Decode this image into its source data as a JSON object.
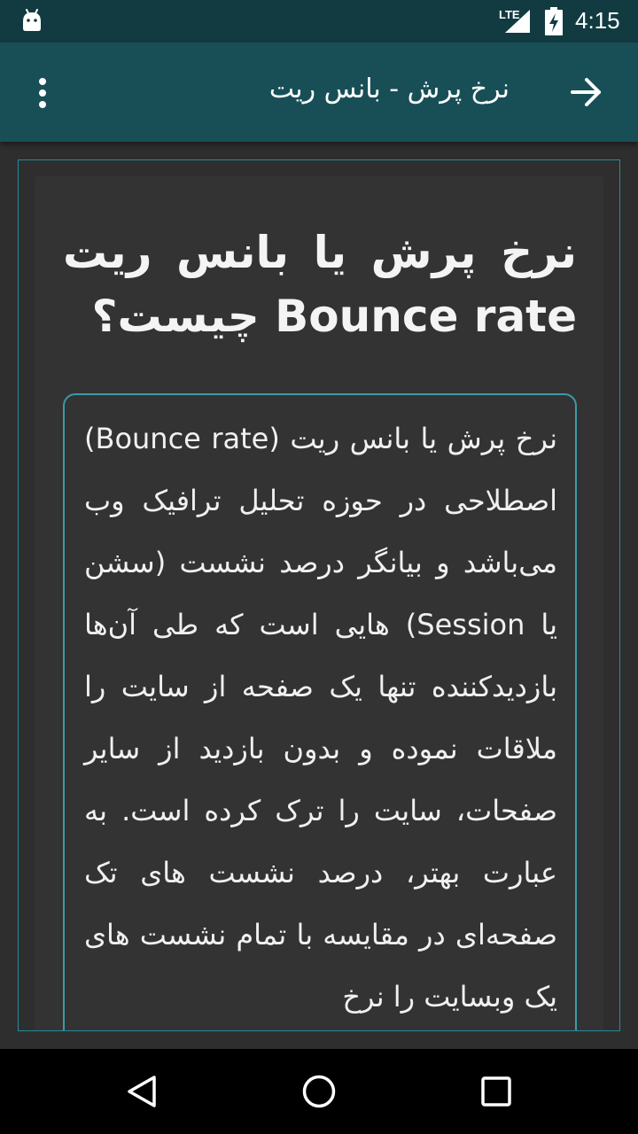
{
  "status_bar": {
    "network_label": "LTE",
    "time": "4:15",
    "icons": [
      "android-icon",
      "signal-icon",
      "battery-charging-icon"
    ]
  },
  "toolbar": {
    "title": "نرخ پرش - بانس ریت",
    "menu_icon": "more-vert-icon",
    "back_icon": "arrow-forward-icon"
  },
  "article": {
    "heading": "نرخ پرش یا بانس ریت Bounce rate چیست؟",
    "body": "نرخ پرش یا بانس ریت (Bounce rate) اصطلاحی در حوزه تحلیل ترافیک وب می‌باشد و بیانگر درصد نشست (سشن یا Session) هایی است که طی آن‌ها بازدیدکننده تنها یک صفحه از سایت را ملاقات نموده و بدون بازدید از سایر صفحات، سایت را ترک کرده است. به عبارت بهتر، درصد نشست های تک صفحه‌ای در مقایسه با تمام نشست های یک وبسایت را نرخ"
  },
  "nav_bar": {
    "icons": [
      "nav-back-icon",
      "nav-home-icon",
      "nav-recents-icon"
    ]
  },
  "colors": {
    "status_bar": "#113b41",
    "app_bar": "#184f57",
    "accent_border": "#2a8a9a",
    "background": "#2e2e2e",
    "text": "#f0f0f0"
  }
}
